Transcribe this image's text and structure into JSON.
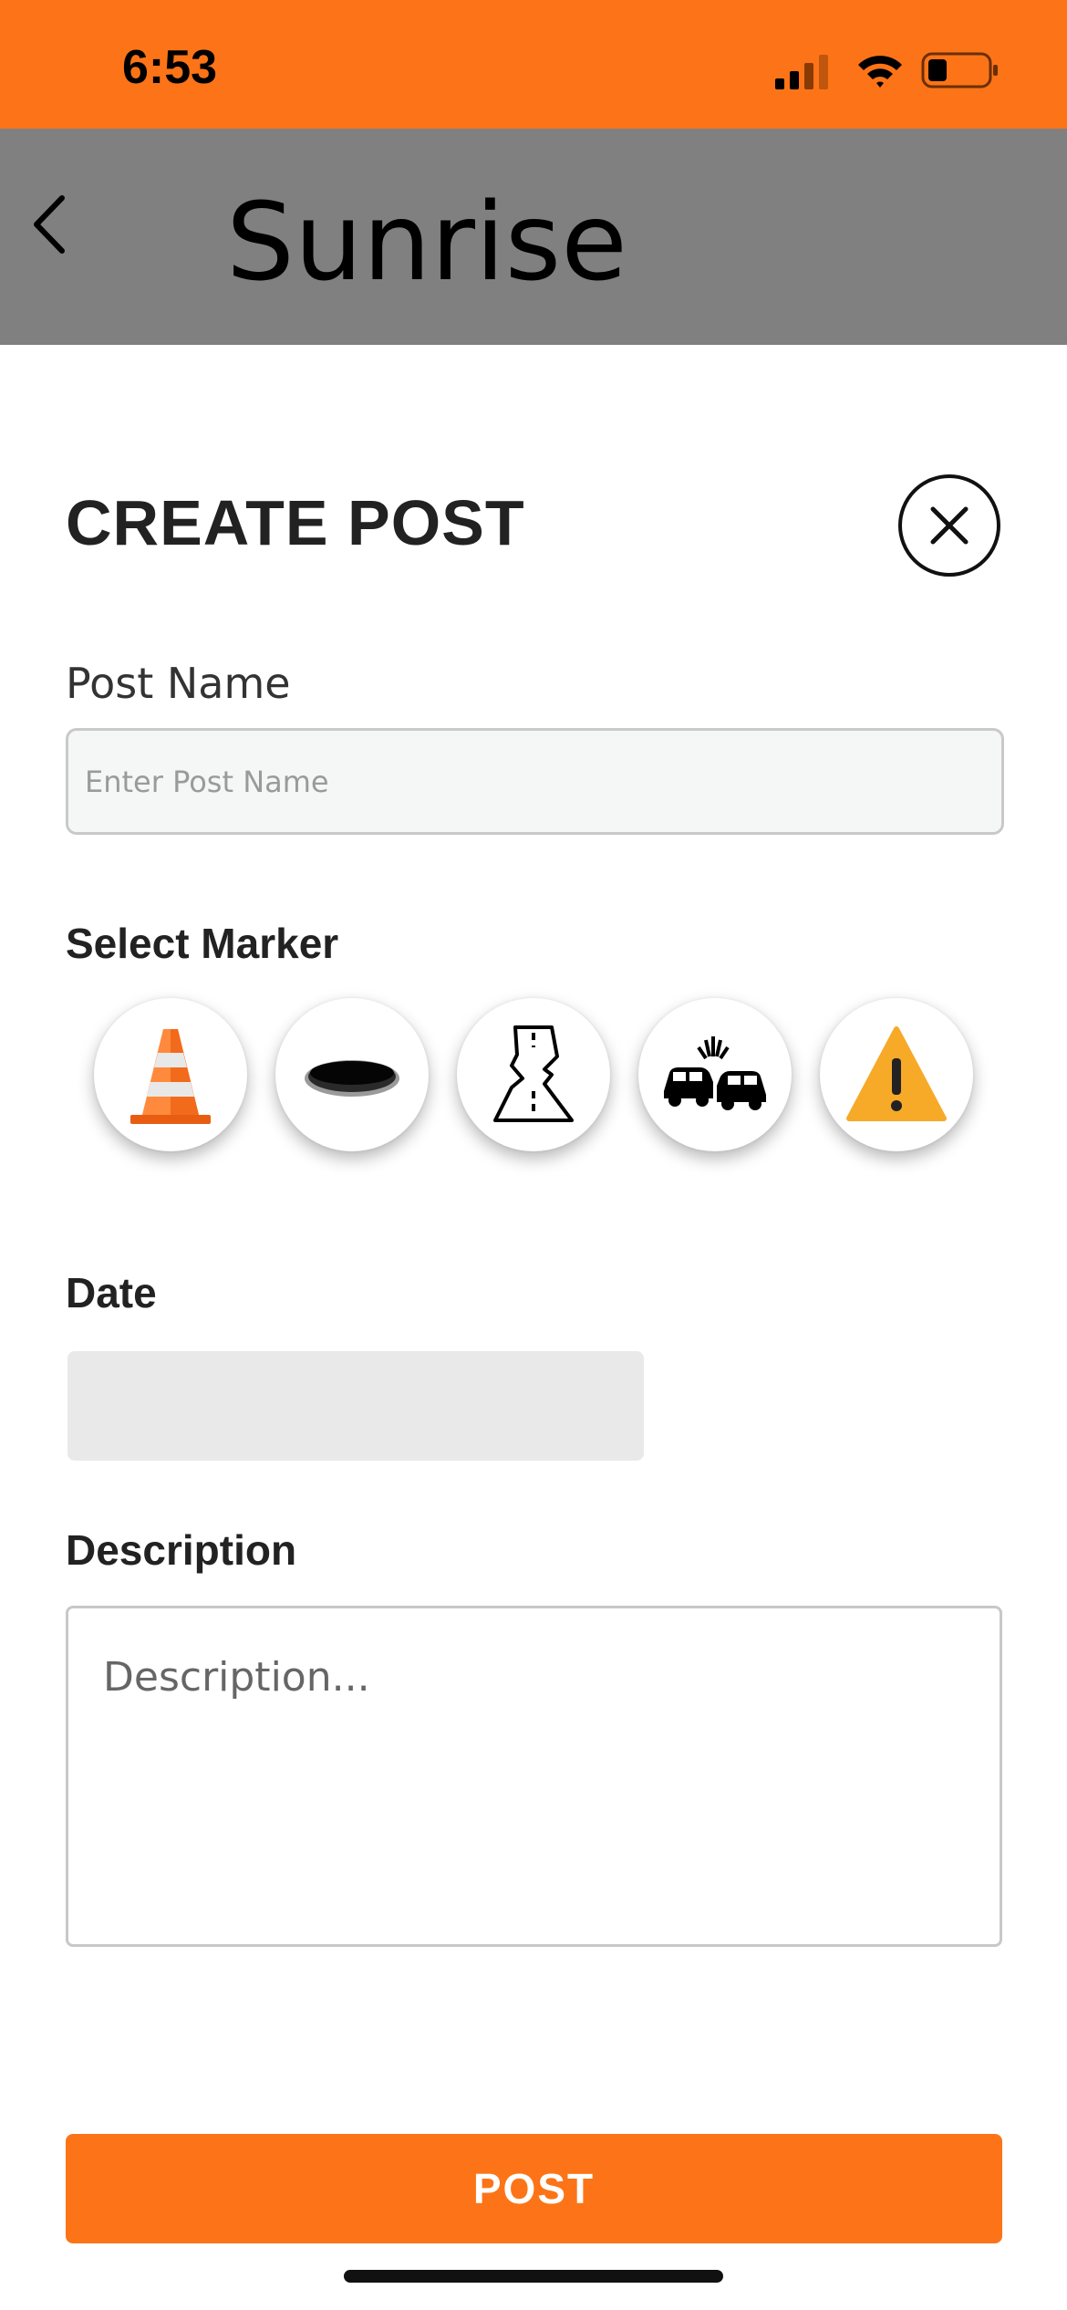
{
  "status_bar": {
    "time": "6:53",
    "icons": [
      "cellular-signal-icon",
      "wifi-icon",
      "battery-icon"
    ],
    "background": "#fc7417"
  },
  "header": {
    "back_icon": "chevron-left-icon",
    "title": "Sunrise",
    "background": "#808080"
  },
  "form": {
    "title": "CREATE POST",
    "close_icon": "close-icon",
    "post_name": {
      "label": "Post Name",
      "placeholder": "Enter Post Name",
      "value": ""
    },
    "marker": {
      "label": "Select Marker",
      "options": [
        {
          "icon": "traffic-cone-icon"
        },
        {
          "icon": "pothole-icon"
        },
        {
          "icon": "cracked-road-icon"
        },
        {
          "icon": "car-crash-icon"
        },
        {
          "icon": "warning-icon"
        }
      ]
    },
    "date": {
      "label": "Date",
      "value": ""
    },
    "description": {
      "label": "Description",
      "placeholder": "Description...",
      "value": ""
    },
    "submit_label": "POST",
    "accent": "#fc7417"
  }
}
